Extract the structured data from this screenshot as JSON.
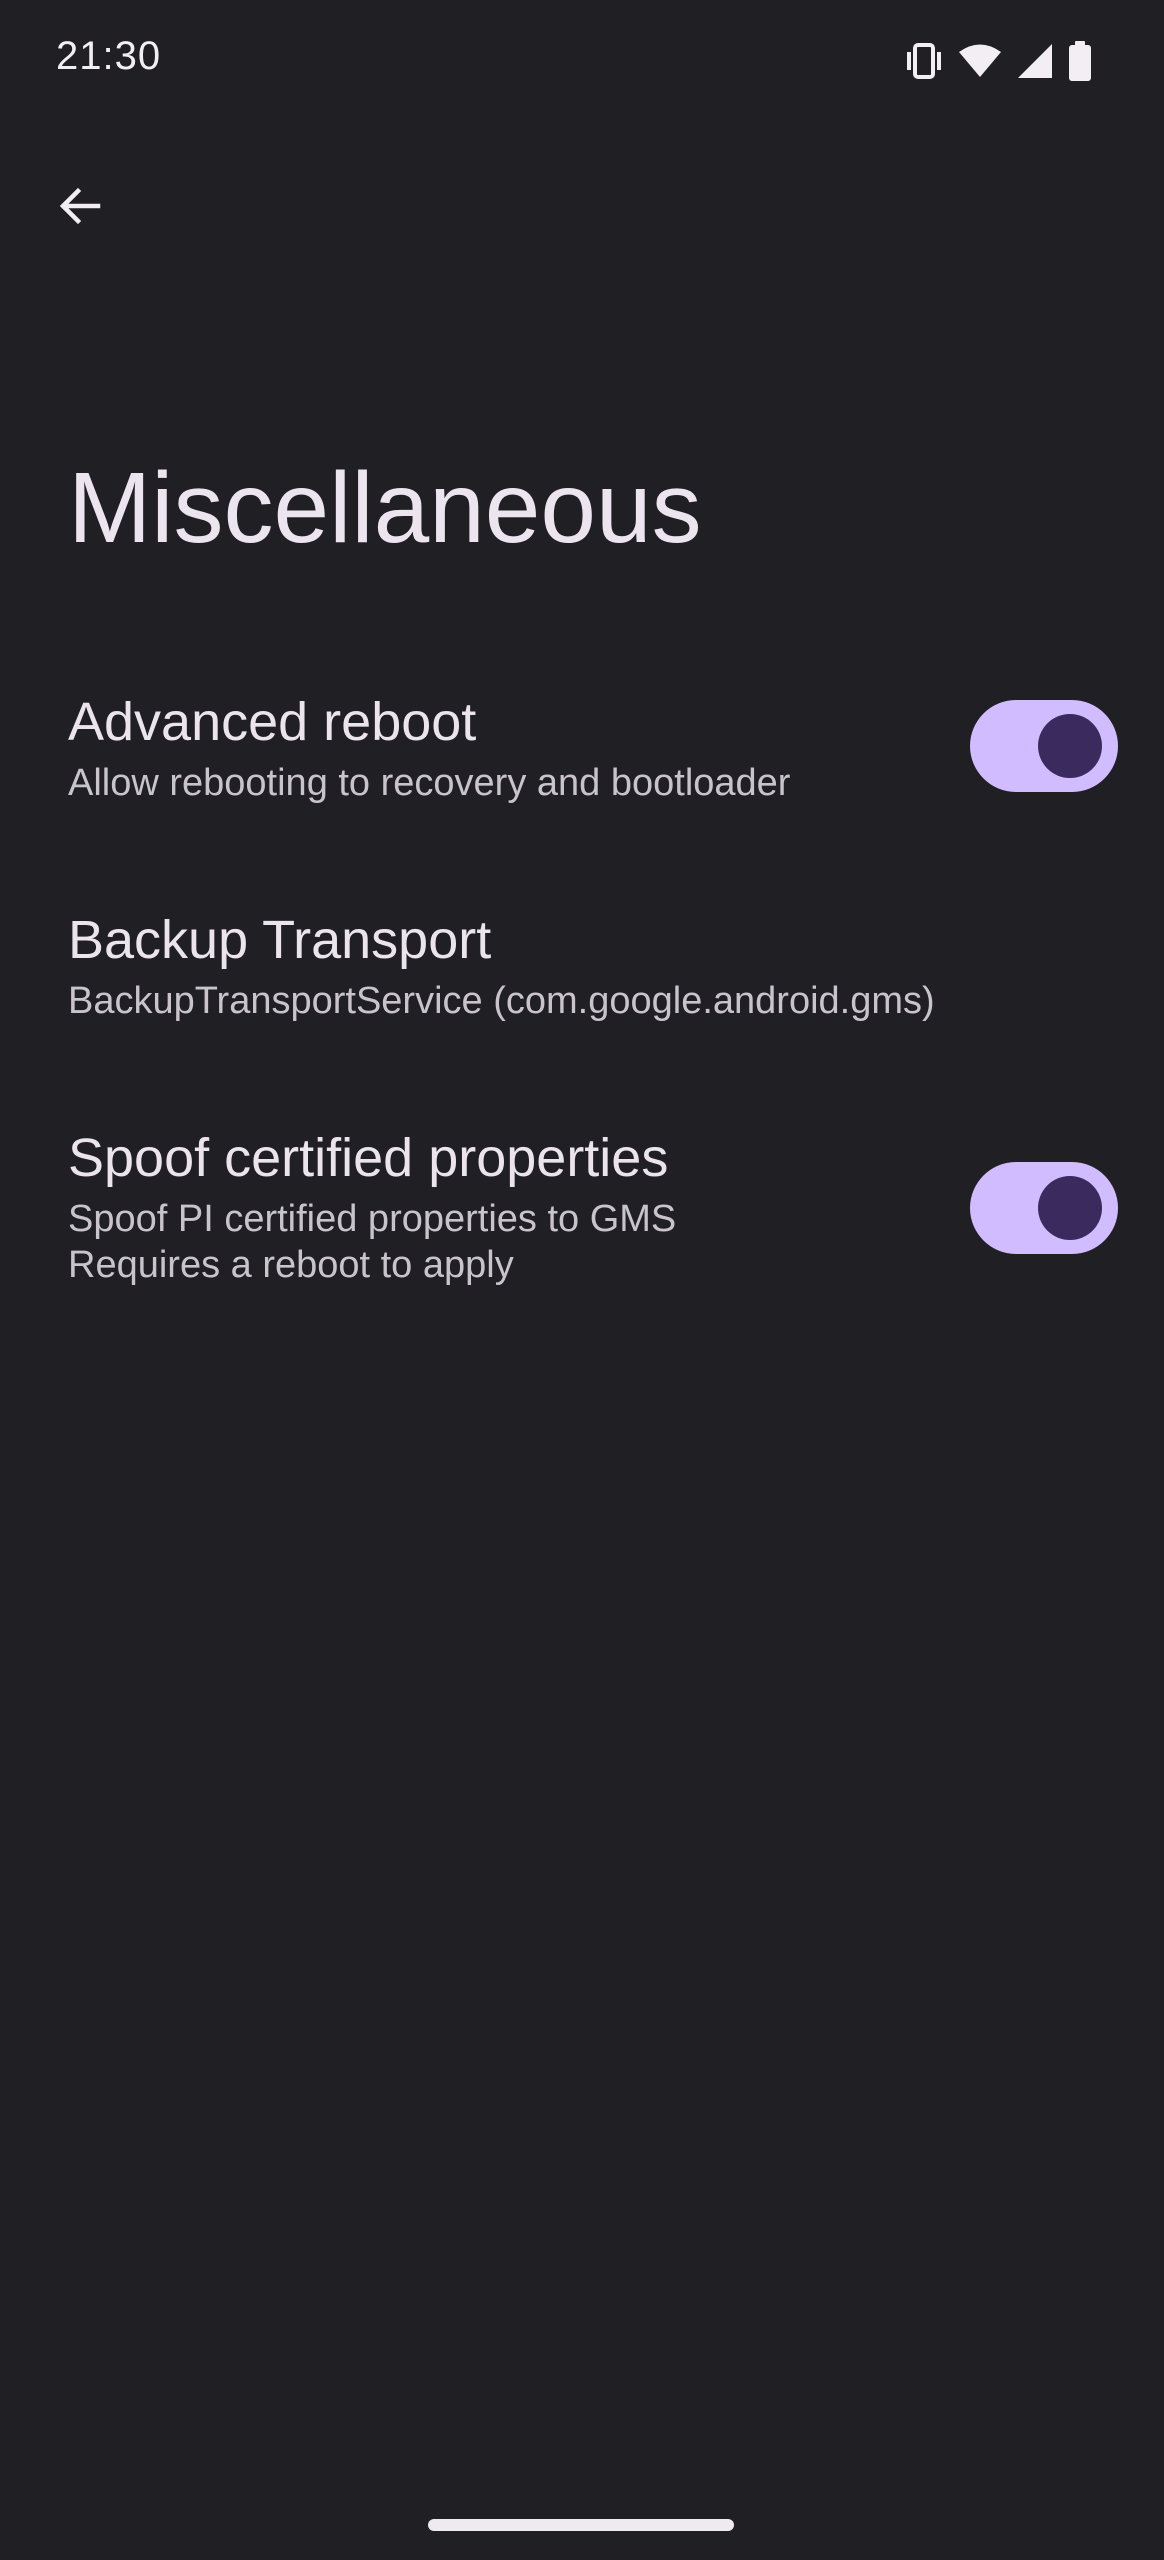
{
  "status_bar": {
    "time": "21:30",
    "icons": [
      "vibrate-icon",
      "wifi-icon",
      "cell-signal-icon",
      "battery-icon"
    ]
  },
  "toolbar": {
    "back_icon": "arrow-back-icon"
  },
  "page": {
    "title": "Miscellaneous"
  },
  "preferences": [
    {
      "title": "Advanced reboot",
      "summary": [
        "Allow rebooting to recovery and bootloader"
      ],
      "has_switch": true,
      "switch_on": true
    },
    {
      "title": "Backup Transport",
      "summary": [
        "BackupTransportService (com.google.android.gms)"
      ],
      "has_switch": false
    },
    {
      "title": "Spoof certified properties",
      "summary": [
        "Spoof PI certified properties to GMS",
        "Requires a reboot to apply"
      ],
      "has_switch": true,
      "switch_on": true
    }
  ],
  "colors": {
    "background": "#201f24",
    "switch_track": "#d0bcff",
    "switch_thumb": "#3b2a5e",
    "title_text": "#ebe4ed",
    "summary_text": "#c9c3cc"
  }
}
